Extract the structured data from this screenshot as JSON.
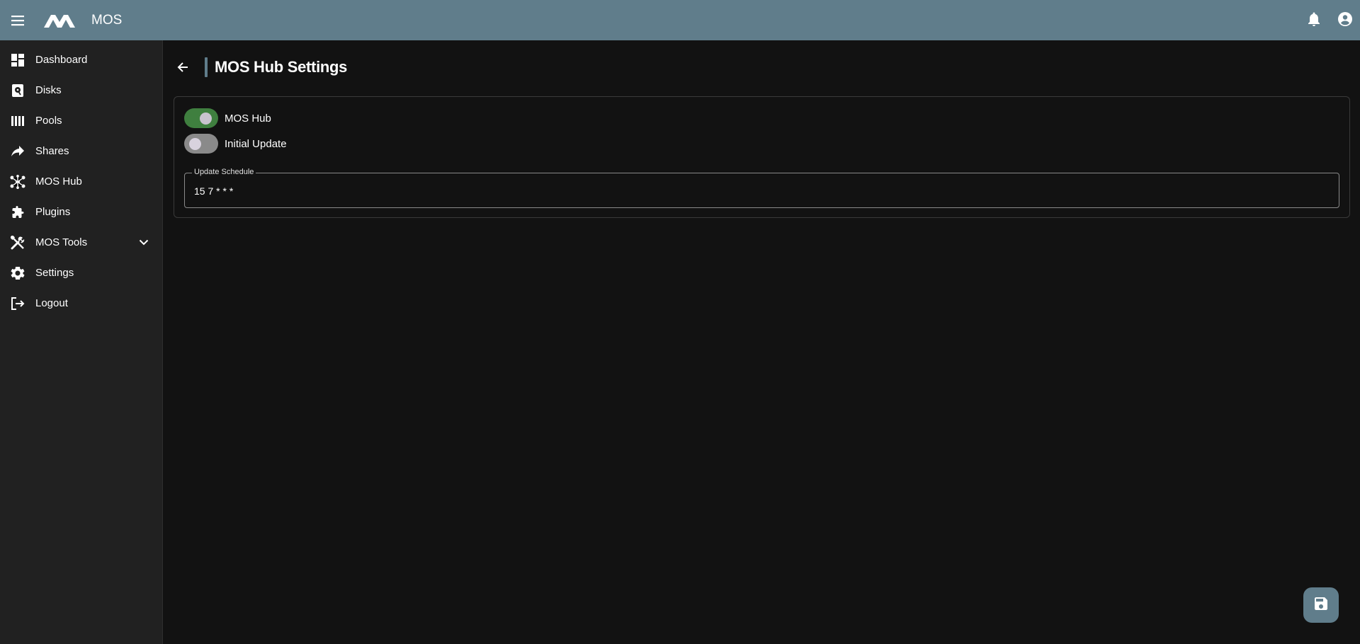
{
  "topbar": {
    "title": "MOS",
    "menu_icon": "hamburger-menu-icon",
    "logo_icon": "mos-logo-icon",
    "notifications_icon": "bell-icon",
    "account_icon": "account-circle-icon",
    "background_color": "#607d8b"
  },
  "sidebar": {
    "items": [
      {
        "label": "Dashboard",
        "icon": "dashboard-icon"
      },
      {
        "label": "Disks",
        "icon": "disk-icon"
      },
      {
        "label": "Pools",
        "icon": "pools-icon"
      },
      {
        "label": "Shares",
        "icon": "share-icon"
      },
      {
        "label": "MOS Hub",
        "icon": "hub-icon"
      },
      {
        "label": "Plugins",
        "icon": "puzzle-icon"
      },
      {
        "label": "MOS Tools",
        "icon": "tools-icon",
        "expandable": true
      },
      {
        "label": "Settings",
        "icon": "gear-icon"
      },
      {
        "label": "Logout",
        "icon": "logout-icon"
      }
    ]
  },
  "main": {
    "title": "MOS Hub Settings",
    "back_icon": "arrow-left-icon",
    "accent_color": "#607d8b",
    "switches": [
      {
        "label": "MOS Hub",
        "on": true
      },
      {
        "label": "Initial Update",
        "on": false
      }
    ],
    "schedule_field": {
      "label": "Update Schedule",
      "value": "15 7 * * *"
    },
    "save_icon": "save-icon"
  }
}
